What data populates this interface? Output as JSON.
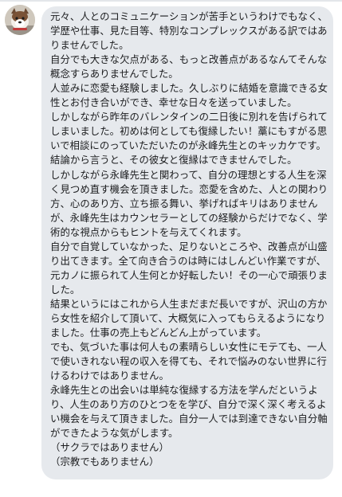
{
  "chat": {
    "sender_avatar_icon": "dog-photo-avatar",
    "bubble_color": "#e6e9ed",
    "message_lines": [
      "元々、人とのコミュニケーションが苦手というわけでもなく、",
      "学歴や仕事、見た目等、特別なコンプレックスがある訳ではあ",
      "りませんでした。",
      "自分でも大きな欠点がある、もっと改善点があるなんてそんな",
      "概念すらありませんでした。",
      "人並みに恋愛も経験しました。久しぶりに結婚を意識できる女",
      "性とお付き合いができ、幸せな日々を送っていました。",
      "しかしながら昨年のバレンタインの二日後に別れを告げられて",
      "しまいました。初めは何としても復縁したい！藁にもすがる思",
      "いで相談にのっていただいたのが永峰先生とのキッカケです。",
      "結論から言うと、その彼女と復縁はできませんでした。",
      "しかしながら永峰先生と関わって、自分の理想とする人生を深",
      "く見つめ直す機会を頂きました。恋愛を含めた、人との関わり",
      "方、心のあり方、立ち振る舞い、挙げればキリはありません",
      "が、永峰先生はカウンセラーとしての経験からだけでなく、学",
      "術的な視点からもヒントを与えてくれます。",
      "自分で自覚していなかった、足りないところや、改善点が山盛",
      "り出てきます。全て向き合うのは時にはしんどい作業ですが、",
      "元カノに振られて人生何とか好転したい！その一心で頑張りま",
      "した。",
      "結果というにはこれから人生まだまだ長いですが、沢山の方か",
      "ら女性を紹介して頂いて、大概気に入ってもらえるようになり",
      "ました。仕事の売上もどんどん上がっています。",
      "でも、気づいた事は何人もの素晴らしい女性にモテても、一人",
      "で使いきれない程の収入を得ても、それで悩みのない世界に行",
      "けるわけではありません。",
      "永峰先生との出会いは単純な復縁する方法を学んだというよ",
      "り、人生のあり方のひとつをを学び、自分で深く深く考えるよ",
      "い機会を与えて頂きました。自分一人では到達できない自分軸",
      "ができたような気がします。",
      "（サクラではありません）",
      "（宗教でもありません）"
    ]
  }
}
